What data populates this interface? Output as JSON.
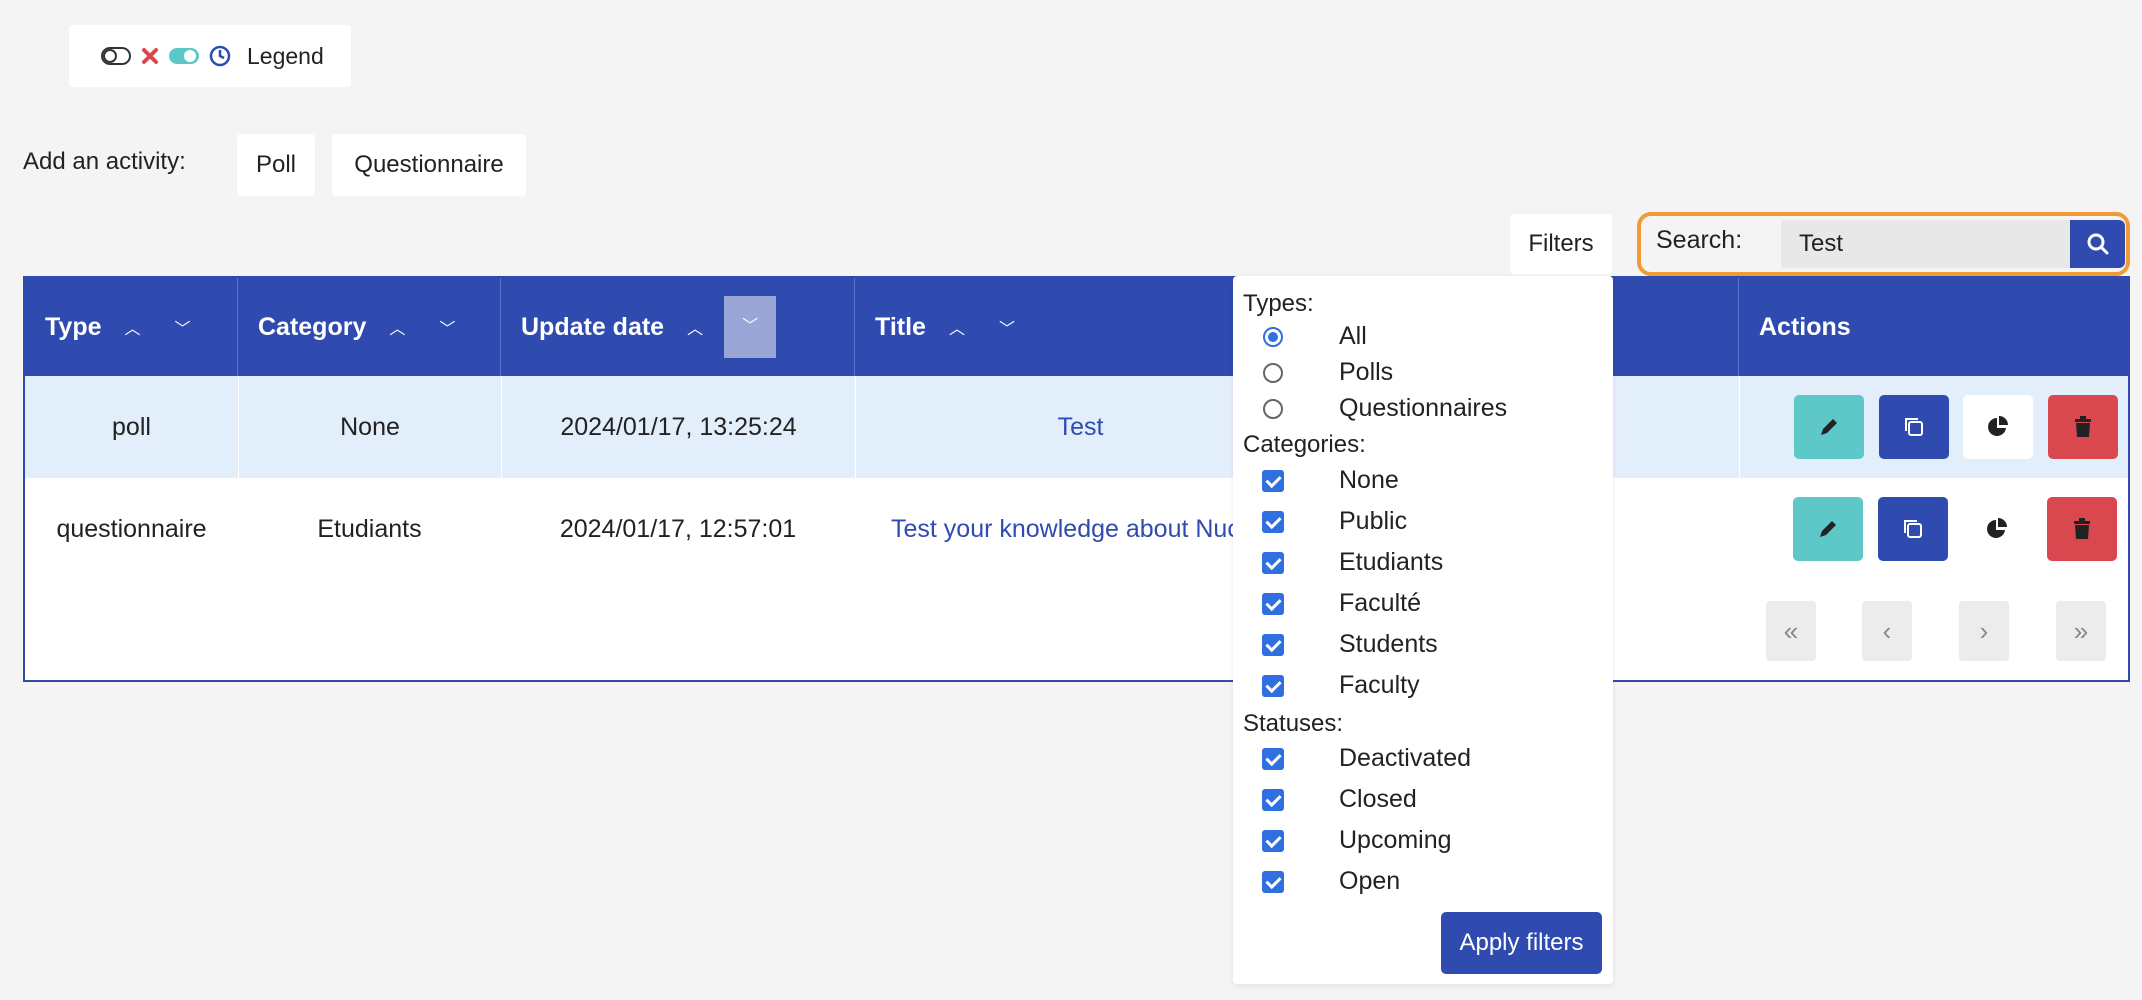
{
  "legend": {
    "label": "Legend",
    "icons": [
      "toggle-off-icon",
      "cross-icon",
      "toggle-on-icon",
      "clock-icon"
    ],
    "colors": {
      "cross": "#d9474f",
      "toggle_on": "#5ec8c8",
      "clock": "#2f4bb0"
    }
  },
  "add_activity": {
    "label": "Add an activity:",
    "buttons": [
      "Poll",
      "Questionnaire"
    ]
  },
  "toolbar": {
    "filters_label": "Filters",
    "search_label": "Search:",
    "search_value": "Test"
  },
  "table": {
    "columns": [
      "Type",
      "Category",
      "Update date",
      "Title",
      "Actions"
    ],
    "rows": [
      {
        "type": "poll",
        "category": "None",
        "update_date": "2024/01/17, 13:25:24",
        "title": "Test"
      },
      {
        "type": "questionnaire",
        "category": "Etudiants",
        "update_date": "2024/01/17, 12:57:01",
        "title": "Test your knowledge about Nuc"
      }
    ],
    "pagination": [
      "«",
      "‹",
      "›",
      "»"
    ]
  },
  "filters": {
    "types_label": "Types:",
    "types": [
      {
        "label": "All",
        "selected": true
      },
      {
        "label": "Polls",
        "selected": false
      },
      {
        "label": "Questionnaires",
        "selected": false
      }
    ],
    "categories_label": "Categories:",
    "categories": [
      "None",
      "Public",
      "Etudiants",
      "Faculté",
      "Students",
      "Faculty"
    ],
    "statuses_label": "Statuses:",
    "statuses": [
      "Deactivated",
      "Closed",
      "Upcoming",
      "Open"
    ],
    "apply_label": "Apply filters"
  },
  "colors": {
    "primary": "#2f4bb0",
    "highlight": "#f29a33",
    "selected_row": "#e3eefb",
    "edit": "#5ec8c8",
    "delete": "#d9474f"
  }
}
